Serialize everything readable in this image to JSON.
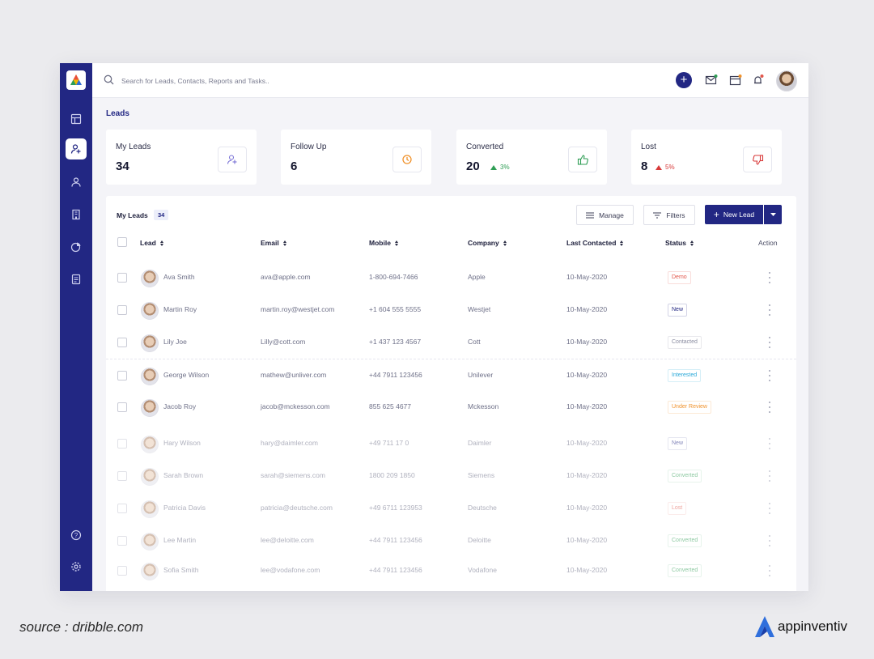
{
  "search": {
    "placeholder": "Search for Leads, Contacts, Reports and Tasks.."
  },
  "page": {
    "title": "Leads"
  },
  "stats": [
    {
      "label": "My Leads",
      "value": "34",
      "icon": "add-user-icon",
      "trend": "",
      "trend_color": ""
    },
    {
      "label": "Follow Up",
      "value": "6",
      "icon": "clock-icon",
      "trend": "",
      "trend_color": ""
    },
    {
      "label": "Converted",
      "value": "20",
      "icon": "thumbs-up-icon",
      "trend": "3%",
      "trend_direction": "up",
      "trend_color": "#2f9e55"
    },
    {
      "label": "Lost",
      "value": "8",
      "icon": "thumbs-down-icon",
      "trend": "5%",
      "trend_direction": "up",
      "trend_color": "#d83a3a"
    }
  ],
  "table": {
    "title": "My Leads",
    "count": "34",
    "manage_label": "Manage",
    "filters_label": "Filters",
    "new_lead_label": "New Lead",
    "columns": [
      "Lead",
      "Email",
      "Mobile",
      "Company",
      "Last Contacted",
      "Status",
      "Action"
    ],
    "rows": [
      {
        "name": "Ava Smith",
        "email": "ava@apple.com",
        "mobile": "1-800-694-7466",
        "company": "Apple",
        "last_contacted": "10-May-2020",
        "status": "Demo",
        "status_color": "#e2574c"
      },
      {
        "name": "Martin Roy",
        "email": "martin.roy@westjet.com",
        "mobile": "+1 604 555 5555",
        "company": "Westjet",
        "last_contacted": "10-May-2020",
        "status": "New",
        "status_color": "#222783"
      },
      {
        "name": "Lily Joe",
        "email": "Lilly@cott.com",
        "mobile": "+1 437 123 4567",
        "company": "Cott",
        "last_contacted": "10-May-2020",
        "status": "Contacted",
        "status_color": "#8a8ca0"
      },
      {
        "name": "George Wilson",
        "email": "mathew@unliver.com",
        "mobile": "+44 7911 123456",
        "company": "Unilever",
        "last_contacted": "10-May-2020",
        "status": "Interested",
        "status_color": "#2aa8d8"
      },
      {
        "name": "Jacob Roy",
        "email": "jacob@mckesson.com",
        "mobile": "855 625 4677",
        "company": "Mckesson",
        "last_contacted": "10-May-2020",
        "status": "Under Review",
        "status_color": "#f0922b"
      },
      {
        "name": "Hary Wilson",
        "email": "hary@daimler.com",
        "mobile": "+49 711 17 0",
        "company": "Daimler",
        "last_contacted": "10-May-2020",
        "status": "New",
        "status_color": "#222783"
      },
      {
        "name": "Sarah Brown",
        "email": "sarah@siemens.com",
        "mobile": "1800 209 1850",
        "company": "Siemens",
        "last_contacted": "10-May-2020",
        "status": "Converted",
        "status_color": "#2f9e55"
      },
      {
        "name": "Patricia Davis",
        "email": "patricia@deutsche.com",
        "mobile": "+49 6711 123953",
        "company": "Deutsche",
        "last_contacted": "10-May-2020",
        "status": "Lost",
        "status_color": "#e2574c"
      },
      {
        "name": "Lee Martin",
        "email": "lee@deloitte.com",
        "mobile": "+44 7911 123456",
        "company": "Deloitte",
        "last_contacted": "10-May-2020",
        "status": "Converted",
        "status_color": "#2f9e55"
      },
      {
        "name": "Sofia Smith",
        "email": "lee@vodafone.com",
        "mobile": "+44 7911 123456",
        "company": "Vodafone",
        "last_contacted": "10-May-2020",
        "status": "Converted",
        "status_color": "#2f9e55"
      }
    ]
  },
  "footer": {
    "source": "source : dribble.com",
    "brand": "appinventiv"
  },
  "colors": {
    "primary": "#222783",
    "background": "#f4f4f8"
  }
}
